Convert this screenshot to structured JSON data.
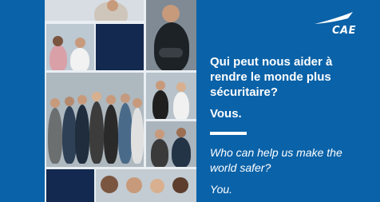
{
  "brand": {
    "name": "CAE",
    "color": "#0a62a8"
  },
  "headline_fr": "Qui peut nous aider à rendre le monde plus sécuritaire?",
  "answer_fr": "Vous.",
  "headline_en": "Who can help us make the world safer?",
  "answer_en": "You."
}
